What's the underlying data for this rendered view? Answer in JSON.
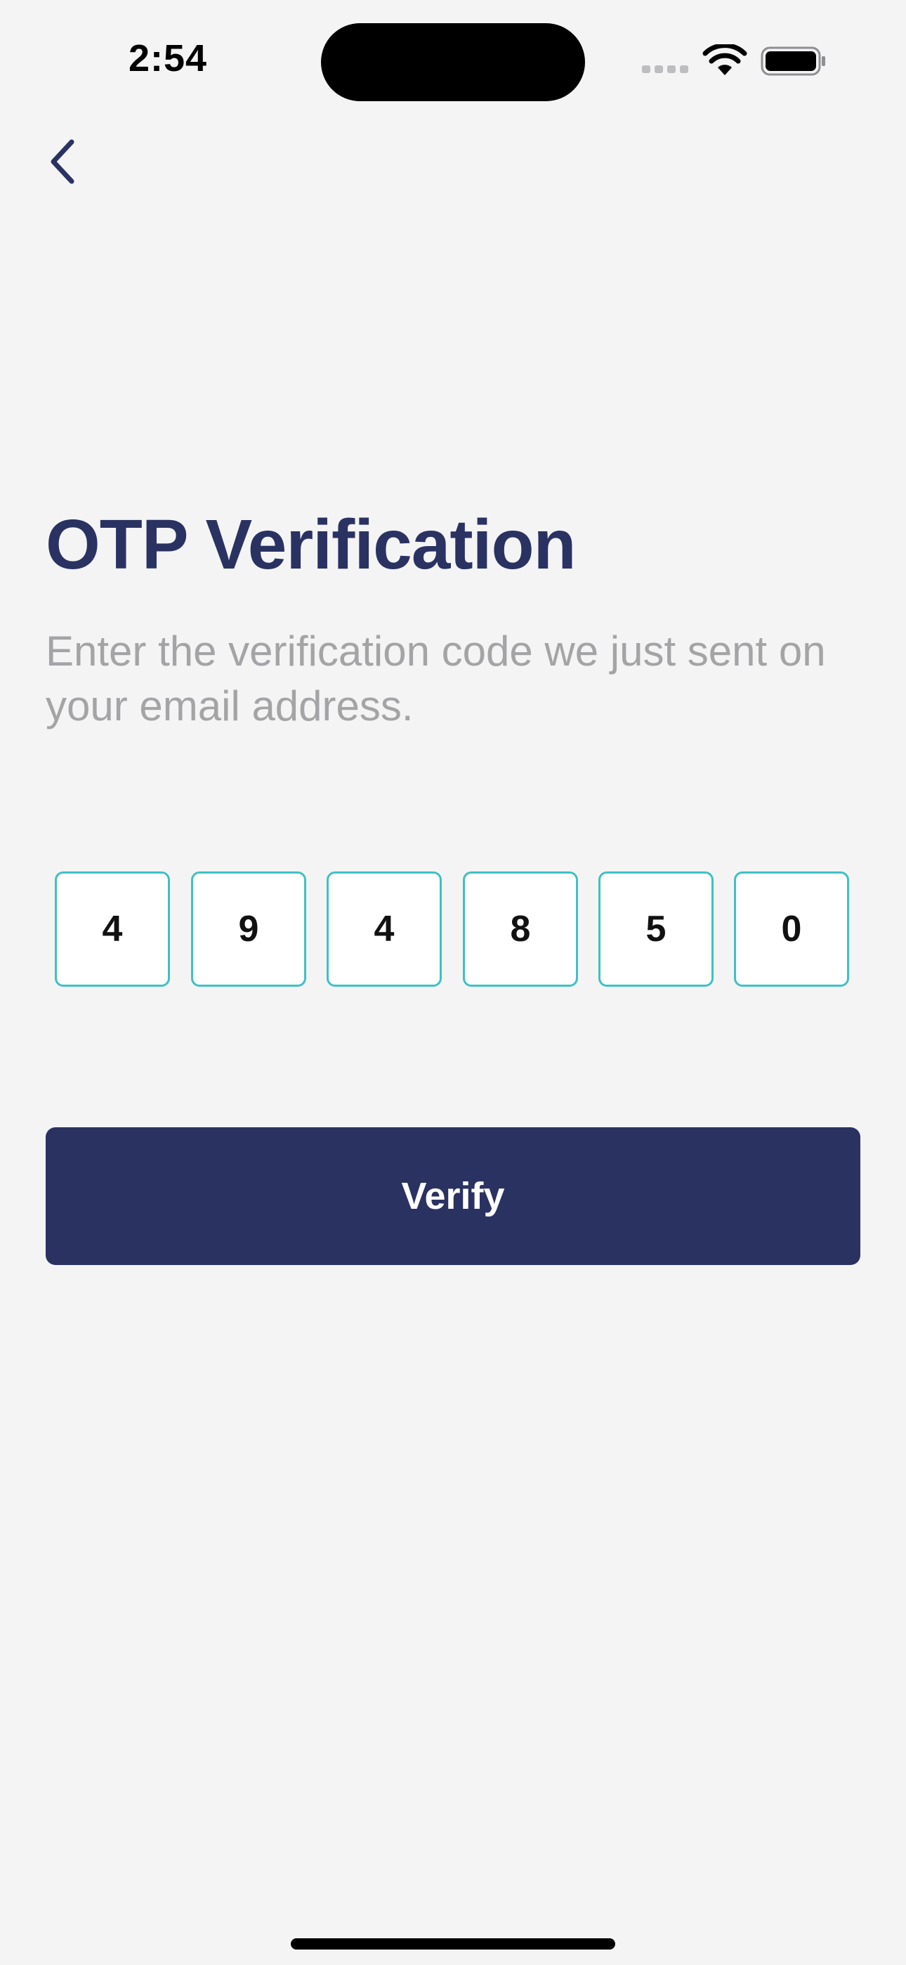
{
  "status_bar": {
    "time": "2:54"
  },
  "header": {
    "back_icon": "chevron-left-icon"
  },
  "main": {
    "title": "OTP Verification",
    "subtitle": "Enter the verification code we just sent on your email address.",
    "otp_digits": [
      "4",
      "9",
      "4",
      "8",
      "5",
      "0"
    ],
    "verify_label": "Verify"
  },
  "colors": {
    "background": "#f4f4f5",
    "primary": "#2a3262",
    "otp_border": "#3fc1c4",
    "subtitle_text": "#a4a4a6"
  }
}
